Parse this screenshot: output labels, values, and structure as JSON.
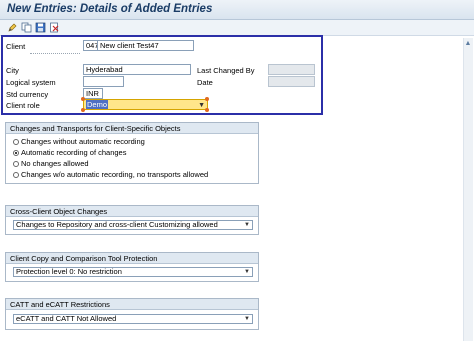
{
  "window": {
    "title": "New Entries: Details of Added Entries"
  },
  "toolbar": {
    "icons": [
      "edit-icon",
      "copy-icon",
      "save-icon",
      "delete-icon"
    ]
  },
  "client_section": {
    "client_label": "Client",
    "client_number": "047",
    "client_name": "New client Test47",
    "city_label": "City",
    "city_value": "Hyderabad",
    "last_changed_label": "Last Changed By",
    "last_changed_value": "",
    "logical_system_label": "Logical system",
    "logical_system_value": "",
    "date_label": "Date",
    "date_value": "",
    "currency_label": "Std currency",
    "currency_value": "INR",
    "role_label": "Client role",
    "role_value": "Demo"
  },
  "transports_group": {
    "title": "Changes and Transports for Client-Specific Objects",
    "options": [
      {
        "label": "Changes without automatic recording",
        "selected": false
      },
      {
        "label": "Automatic recording of changes",
        "selected": true
      },
      {
        "label": "No changes allowed",
        "selected": false
      },
      {
        "label": "Changes w/o automatic recording, no transports allowed",
        "selected": false
      }
    ]
  },
  "cross_client_group": {
    "title": "Cross-Client Object Changes",
    "value": "Changes to Repository and cross-client Customizing allowed"
  },
  "protection_group": {
    "title": "Client Copy and Comparison Tool Protection",
    "value": "Protection level 0: No restriction"
  },
  "catt_group": {
    "title": "CATT and eCATT Restrictions",
    "value": "eCATT and CATT Not Allowed"
  }
}
